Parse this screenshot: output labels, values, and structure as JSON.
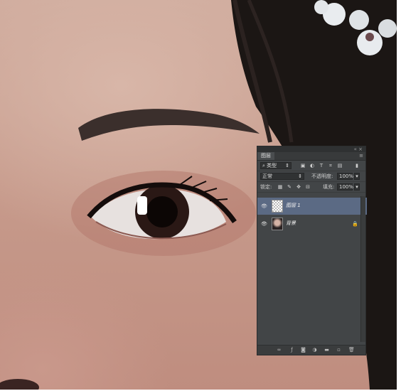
{
  "layers_panel": {
    "tab_label": "图层",
    "filter_kind": "类型",
    "blend_mode": "正常",
    "opacity_label": "不透明度:",
    "opacity_value": "100%",
    "lock_label": "锁定:",
    "fill_label": "填充:",
    "fill_value": "100%",
    "layers": [
      {
        "name": "图层 1",
        "thumbnail": "transparent",
        "selected": true,
        "visible": true
      },
      {
        "name": "背景",
        "thumbnail": "photo",
        "selected": false,
        "visible": true,
        "locked": true
      }
    ]
  },
  "icons": [
    "collapse-icon",
    "panel-menu-icon",
    "search-icon",
    "image-filter-icon",
    "adjustment-filter-icon",
    "type-filter-icon",
    "shape-filter-icon",
    "smart-object-filter-icon",
    "filter-toggle-icon",
    "dropdown-chevron-icon",
    "lock-pixels-icon",
    "lock-paint-icon",
    "lock-position-icon",
    "lock-all-icon",
    "eye-icon",
    "lock-icon",
    "link-icon",
    "fx-icon",
    "mask-icon",
    "adjustment-layer-icon",
    "group-icon",
    "new-layer-icon",
    "trash-icon"
  ],
  "colors": {
    "panel_bg": "#424547",
    "selected_layer": "#5b6a84",
    "skin": "#c99c8d",
    "hair": "#1a1614"
  }
}
